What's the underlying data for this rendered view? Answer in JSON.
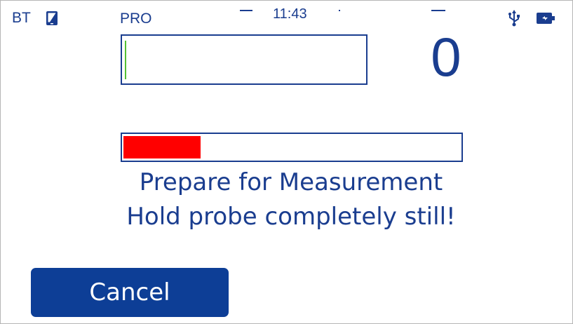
{
  "status_bar": {
    "bt_label": "BT",
    "mode_label": "PRO",
    "time": "11:43",
    "icons": [
      "tablet-icon",
      "usb-icon",
      "battery-charging-icon"
    ]
  },
  "measurement": {
    "value_field": "",
    "count": "0",
    "progress_fraction": 0.23
  },
  "messages": {
    "line1": "Prepare for Measurement",
    "line2": "Hold probe completely still!"
  },
  "actions": {
    "cancel_label": "Cancel"
  },
  "colors": {
    "accent": "#1a3d8f",
    "button": "#0d3e96",
    "progress": "#ff0000",
    "cursor": "#54c034"
  }
}
